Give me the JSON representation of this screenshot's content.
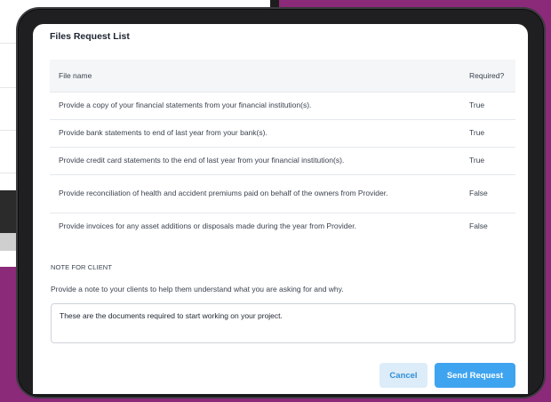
{
  "modal": {
    "title": "Files Request List",
    "table": {
      "headers": {
        "file_name": "File name",
        "required": "Required?"
      },
      "rows": [
        {
          "file_name": "Provide a copy of your financial statements from your financial institution(s).",
          "required": "True"
        },
        {
          "file_name": "Provide bank statements to end of last year from your bank(s).",
          "required": "True"
        },
        {
          "file_name": "Provide credit card statements to the end of last year from your financial institution(s).",
          "required": "True"
        },
        {
          "file_name": "Provide reconciliation of health and accident premiums paid on behalf of the owners from Provider.",
          "required": "False"
        },
        {
          "file_name": "Provide invoices for any asset additions or disposals made during the year from Provider.",
          "required": "False"
        }
      ]
    },
    "note": {
      "heading": "NOTE FOR CLIENT",
      "description": "Provide a note to your clients to help them understand what you are asking for and why.",
      "value": "These are the documents required to start working on your project."
    },
    "buttons": {
      "cancel": "Cancel",
      "send": "Send Request"
    },
    "colors": {
      "accent": "#3fa4ef",
      "background": "#8a2a78"
    }
  }
}
